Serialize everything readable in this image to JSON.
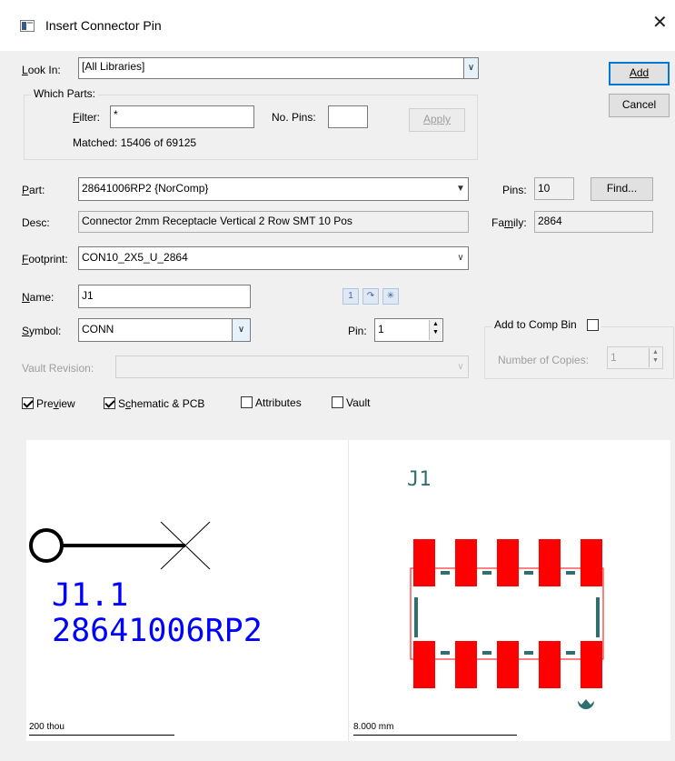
{
  "window": {
    "title": "Insert Connector Pin",
    "close_glyph": "✕"
  },
  "look_in": {
    "label": "Look In:",
    "value": "[All Libraries]"
  },
  "which_parts": {
    "caption": "Which Parts:",
    "filter_label": "Filter:",
    "filter_value": "*",
    "no_pins_label": "No. Pins:",
    "no_pins_value": "",
    "apply_label": "Apply",
    "matched_text": "Matched: 15406 of 69125"
  },
  "buttons": {
    "add": "Add",
    "cancel": "Cancel",
    "find": "Find..."
  },
  "part": {
    "label": "Part:",
    "value": "28641006RP2 {NorComp}",
    "pins_label": "Pins:",
    "pins_value": "10"
  },
  "desc": {
    "label": "Desc:",
    "value": "Connector 2mm Receptacle Vertical 2 Row SMT 10 Pos",
    "family_label": "Family:",
    "family_value": "2864"
  },
  "footprint": {
    "label": "Footprint:",
    "value": "CON10_2X5_U_2864"
  },
  "name": {
    "label": "Name:",
    "value": "J1",
    "tool_1": "1"
  },
  "symbol": {
    "label": "Symbol:",
    "value": "CONN",
    "pin_label": "Pin:",
    "pin_value": "1"
  },
  "comp_bin": {
    "label": "Add to Comp Bin",
    "checked": false,
    "copies_label": "Number of Copies:",
    "copies_value": "1"
  },
  "vault_revision": {
    "label": "Vault Revision:",
    "value": ""
  },
  "options": {
    "preview": {
      "label": "Preview",
      "checked": true
    },
    "schematic_pcb": {
      "label": "Schematic & PCB",
      "checked": true
    },
    "attributes": {
      "label": "Attributes",
      "checked": false
    },
    "vault": {
      "label": "Vault",
      "checked": false
    }
  },
  "preview": {
    "schematic": {
      "ref": "J1.1",
      "part": "28641006RP2",
      "scale": "200 thou"
    },
    "pcb": {
      "ref": "J1",
      "scale": "8.000 mm"
    }
  },
  "colors": {
    "schematic_text": "#0000ff",
    "pad": "#ff0000",
    "silk": "#2f6f6f"
  }
}
